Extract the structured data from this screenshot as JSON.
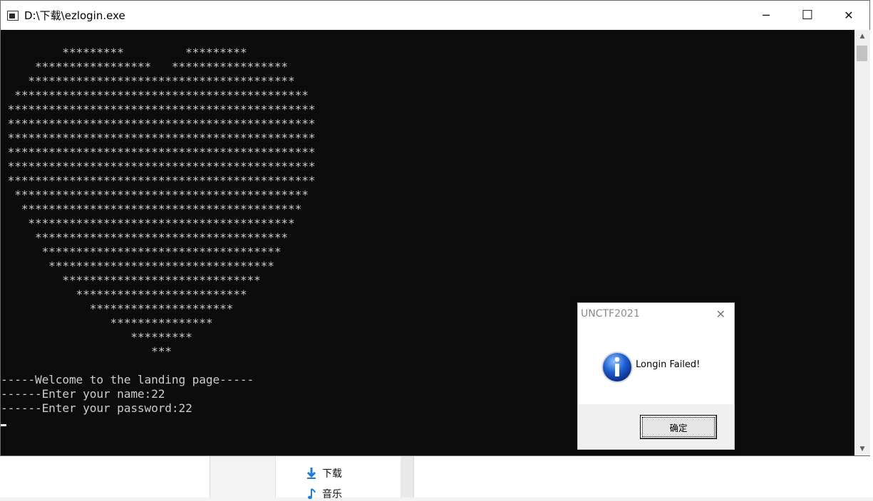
{
  "console": {
    "title": "D:\\下载\\ezlogin.exe",
    "lines": [
      "         *********         *********",
      "     *****************   *****************",
      "    ***************************************",
      "  *******************************************",
      " *********************************************",
      " *********************************************",
      " *********************************************",
      " *********************************************",
      " *********************************************",
      " *********************************************",
      "  *******************************************",
      "   *****************************************",
      "    ***************************************",
      "     *************************************",
      "      ***********************************",
      "       *********************************",
      "         *****************************",
      "           *************************",
      "             *********************",
      "                ***************",
      "                   *********",
      "                      ***",
      "",
      "-----Welcome to the landing page-----",
      "------Enter your name:22",
      "------Enter your password:22"
    ]
  },
  "window_controls": {
    "minimize": "─",
    "maximize": "☐",
    "close": "✕"
  },
  "dialog": {
    "title": "UNCTF2021",
    "message": "Longin Failed!",
    "ok_label": "确定",
    "icon": "info-icon"
  },
  "explorer_nav": {
    "items": [
      {
        "label": "下载",
        "icon": "download-arrow-icon"
      },
      {
        "label": "音乐",
        "icon": "music-note-icon"
      }
    ]
  }
}
